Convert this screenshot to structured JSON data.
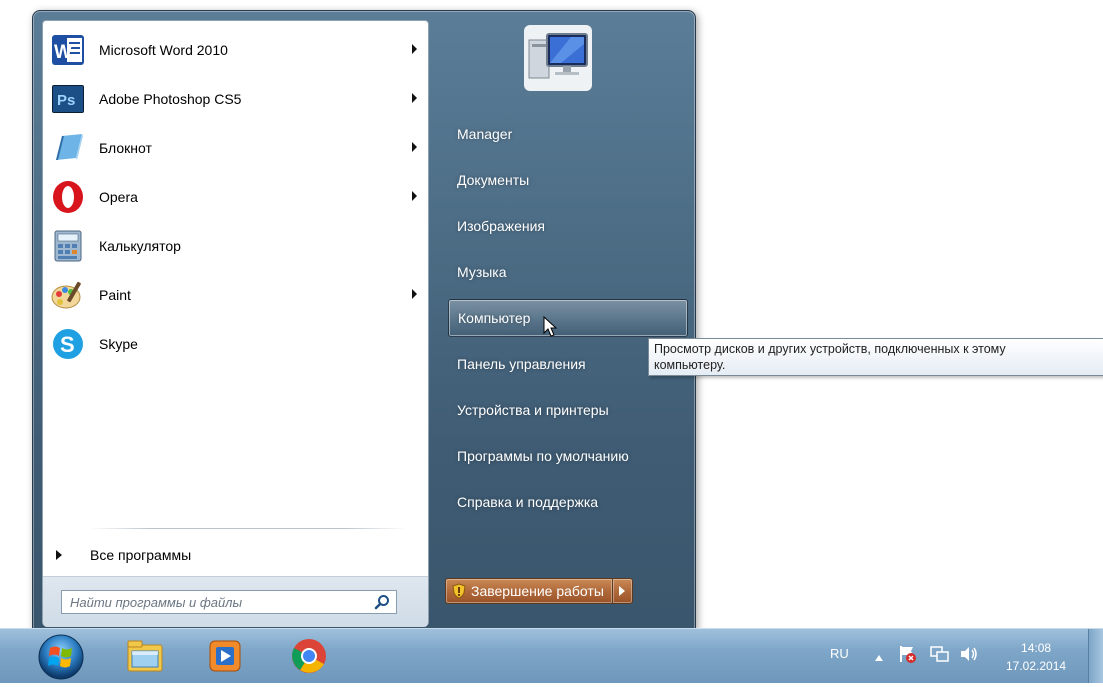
{
  "start_menu": {
    "programs": [
      {
        "label": "Microsoft Word 2010",
        "icon": "word-icon",
        "has_submenu": true
      },
      {
        "label": "Adobe Photoshop CS5",
        "icon": "photoshop-icon",
        "has_submenu": true
      },
      {
        "label": "Блокнот",
        "icon": "notepad-icon",
        "has_submenu": true
      },
      {
        "label": "Opera",
        "icon": "opera-icon",
        "has_submenu": true
      },
      {
        "label": "Калькулятор",
        "icon": "calculator-icon",
        "has_submenu": false
      },
      {
        "label": "Paint",
        "icon": "paint-icon",
        "has_submenu": true
      },
      {
        "label": "Skype",
        "icon": "skype-icon",
        "has_submenu": false
      }
    ],
    "all_programs_label": "Все программы",
    "search": {
      "placeholder": "Найти программы и файлы",
      "value": ""
    },
    "places": [
      {
        "label": "Manager",
        "hovered": false
      },
      {
        "label": "Документы",
        "hovered": false
      },
      {
        "label": "Изображения",
        "hovered": false
      },
      {
        "label": "Музыка",
        "hovered": false
      },
      {
        "label": "Компьютер",
        "hovered": true
      },
      {
        "label": "Панель управления",
        "hovered": false
      },
      {
        "label": "Устройства и принтеры",
        "hovered": false
      },
      {
        "label": "Программы по умолчанию",
        "hovered": false
      },
      {
        "label": "Справка и поддержка",
        "hovered": false
      }
    ],
    "shutdown_label": "Завершение работы"
  },
  "tooltip": {
    "line1": "Просмотр дисков и других устройств, подключенных к этому",
    "line2": "компьютеру."
  },
  "taskbar": {
    "pinned": [
      "explorer-icon",
      "media-player-icon",
      "chrome-icon"
    ],
    "tray": {
      "language": "RU",
      "time": "14:08",
      "date": "17.02.2014"
    }
  },
  "colors": {
    "menu_right_panel": "#4d6d86",
    "taskbar": "#7ea6c8",
    "shutdown_button": "#b0693a"
  }
}
